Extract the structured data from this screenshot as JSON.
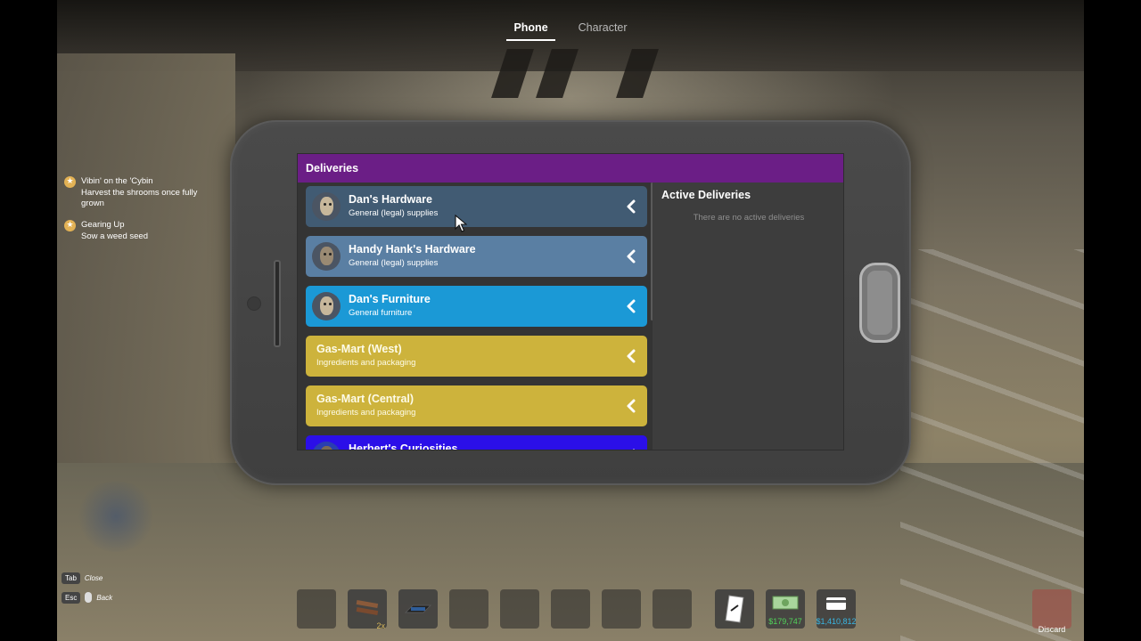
{
  "top_tabs": [
    {
      "label": "Phone",
      "active": true
    },
    {
      "label": "Character",
      "active": false
    }
  ],
  "objectives": [
    {
      "title": "Vibin' on the 'Cybin",
      "description": "Harvest the shrooms once fully grown"
    },
    {
      "title": "Gearing Up",
      "description": "Sow a weed seed"
    }
  ],
  "phone": {
    "app_title": "Deliveries",
    "shops": [
      {
        "name": "Dan's Hardware",
        "description": "General (legal) supplies",
        "color": "#415b73",
        "has_avatar": true
      },
      {
        "name": "Handy Hank's Hardware",
        "description": "General (legal) supplies",
        "color": "#5a7fa3",
        "has_avatar": true
      },
      {
        "name": "Dan's Furniture",
        "description": "General furniture",
        "color": "#1b99d6",
        "has_avatar": true
      },
      {
        "name": "Gas-Mart (West)",
        "description": "Ingredients and packaging",
        "color": "#cdb33c",
        "has_avatar": false
      },
      {
        "name": "Gas-Mart (Central)",
        "description": "Ingredients and packaging",
        "color": "#cdb33c",
        "has_avatar": false
      },
      {
        "name": "Herbert's Curiosities",
        "description": "",
        "color": "#2b0fe8",
        "has_avatar": true
      }
    ],
    "active_deliveries": {
      "title": "Active Deliveries",
      "empty_text": "There are no active deliveries"
    }
  },
  "keybinds": [
    {
      "key": "Tab",
      "label": "Close"
    },
    {
      "key": "Esc",
      "label": "Back"
    }
  ],
  "hotbar": {
    "slot2_count": "2x",
    "cash": "$179,747",
    "bank": "$1,410,812",
    "discard_label": "Discard"
  },
  "colors": {
    "header": "#6b1e86",
    "cash": "#52d35a",
    "bank": "#39b6e3"
  }
}
